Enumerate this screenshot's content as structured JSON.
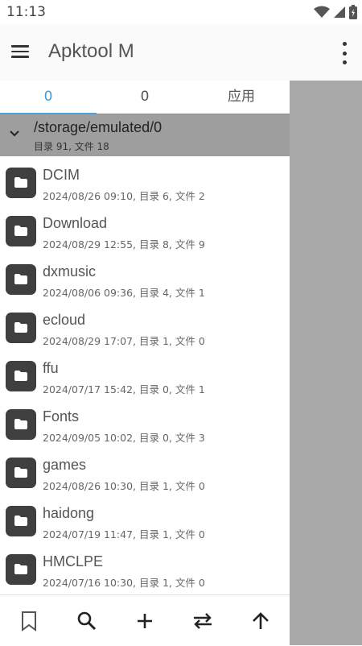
{
  "status": {
    "time": "11:13",
    "icons": [
      "wifi-icon",
      "signal-icon",
      "battery-icon"
    ]
  },
  "appbar": {
    "title": "Apktool M",
    "menu_icon": "hamburger-icon",
    "more_icon": "more-vert-icon"
  },
  "tabs": [
    {
      "label": "0",
      "active": true
    },
    {
      "label": "0",
      "active": false
    },
    {
      "label": "应用",
      "active": false
    }
  ],
  "path": {
    "current": "/storage/emulated/0",
    "summary": "目录 91, 文件 18"
  },
  "items": [
    {
      "name": "DCIM",
      "meta": "2024/08/26 09:10, 目录 6, 文件 2"
    },
    {
      "name": "Download",
      "meta": "2024/08/29 12:55, 目录 8, 文件 9"
    },
    {
      "name": "dxmusic",
      "meta": "2024/08/06 09:36, 目录 4, 文件 1"
    },
    {
      "name": "ecloud",
      "meta": "2024/08/29 17:07, 目录 1, 文件 0"
    },
    {
      "name": "ffu",
      "meta": "2024/07/17 15:42, 目录 0, 文件 1"
    },
    {
      "name": "Fonts",
      "meta": "2024/09/05 10:02, 目录 0, 文件 3"
    },
    {
      "name": "games",
      "meta": "2024/08/26 10:30, 目录 1, 文件 0"
    },
    {
      "name": "haidong",
      "meta": "2024/07/19 11:47, 目录 1, 文件 0"
    },
    {
      "name": "HMCLPE",
      "meta": "2024/07/16 10:30, 目录 1, 文件 0"
    }
  ],
  "bottom_actions": [
    "bookmark-icon",
    "search-icon",
    "add-icon",
    "swap-icon",
    "arrow-up-icon"
  ]
}
